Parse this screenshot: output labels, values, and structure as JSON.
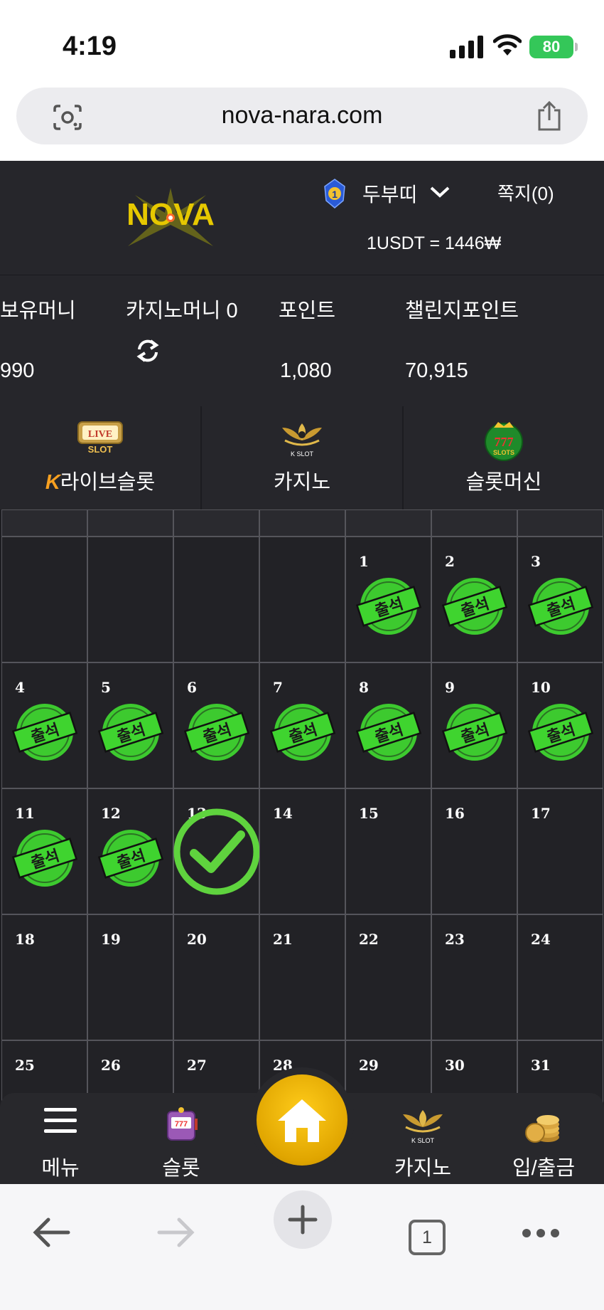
{
  "status_bar": {
    "time": "4:19",
    "battery": "80"
  },
  "browser": {
    "url": "nova-nara.com",
    "tab_count": "1"
  },
  "header": {
    "logo_text": "NOVA",
    "level": "1",
    "username": "두부띠",
    "messages": "쪽지(0)",
    "rate": "1USDT = 1446₩"
  },
  "balances": {
    "holding_label": "보유머니",
    "holding_value": "990",
    "casino_label": "카지노머니 0",
    "point_label": "포인트",
    "point_value": "1,080",
    "challenge_label": "챌린지포인트",
    "challenge_value": "70,915"
  },
  "game_tabs": [
    {
      "label": "라이브슬롯",
      "icon": "live-slot-icon",
      "prefix": "K"
    },
    {
      "label": "카지노",
      "icon": "k-slot-icon"
    },
    {
      "label": "슬롯머신",
      "icon": "777-slots-icon"
    }
  ],
  "calendar": {
    "stamp_text": "출석",
    "checked_days": [
      "1",
      "2",
      "3",
      "4",
      "5",
      "6",
      "7",
      "8",
      "9",
      "10",
      "11",
      "12"
    ],
    "today": "13",
    "rows": [
      [
        "",
        "",
        "",
        "",
        "1",
        "2",
        "3"
      ],
      [
        "4",
        "5",
        "6",
        "7",
        "8",
        "9",
        "10"
      ],
      [
        "11",
        "12",
        "13",
        "14",
        "15",
        "16",
        "17"
      ],
      [
        "18",
        "19",
        "20",
        "21",
        "22",
        "23",
        "24"
      ],
      [
        "25",
        "26",
        "27",
        "28",
        "29",
        "30",
        "31"
      ]
    ]
  },
  "bottom_nav": {
    "menu": "메뉴",
    "slot": "슬롯",
    "casino": "카지노",
    "deposit": "입/출금"
  },
  "colors": {
    "stamp_green": "#3fd42f",
    "check_green": "#5fd33e",
    "home_gold": "#f2b705",
    "bg": "#1e1e22"
  }
}
